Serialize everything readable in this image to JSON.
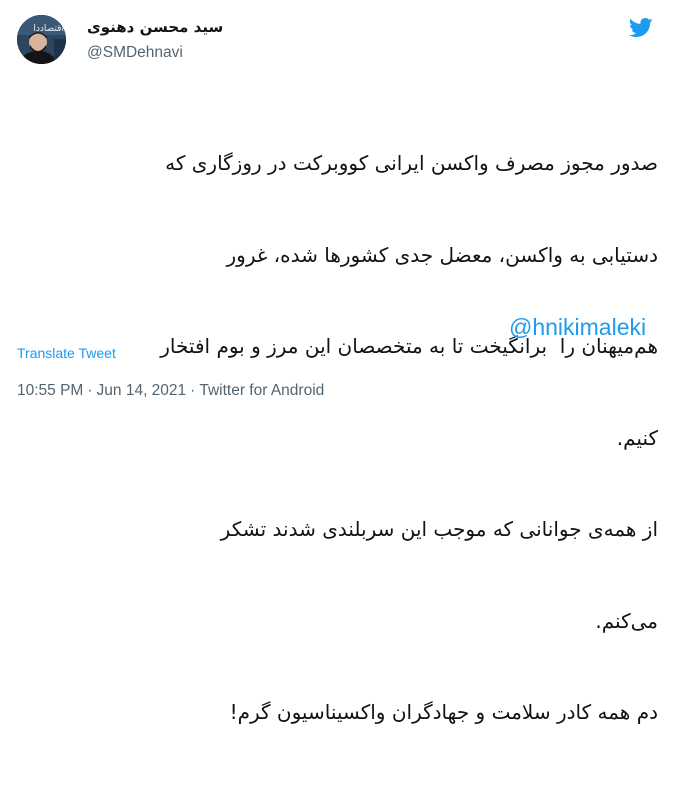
{
  "author": {
    "display_name": "سید محسن دهنوی",
    "handle": "@SMDehnavi",
    "avatar_text": "اقتصاددا"
  },
  "tweet": {
    "lines": [
      "صدور مجوز مصرف واکسن ایرانی کووبرکت در روزگاری که",
      "دستیابی به واکسن، معضل جدی کشورها شده، غرور",
      "هم‌میهنان را  برانگیخت تا به متخصصان این مرز و بوم افتخار",
      "کنیم.",
      "از همه‌ی جوانانی که موجب این سربلندی شدند تشکر",
      "می‌کنم.",
      "دم همه کادر سلامت و جهادگران واکسیناسیون گرم!"
    ],
    "mention": "@hnikimaleki"
  },
  "actions": {
    "translate_label": "Translate Tweet"
  },
  "meta": {
    "time": "10:55 PM",
    "separator": "·",
    "date": "Jun 14, 2021",
    "source": "Twitter for Android"
  },
  "icons": {
    "brand": "twitter-bird-icon"
  },
  "colors": {
    "accent": "#1d9bf0",
    "text": "#0f1419",
    "secondary": "#536471"
  }
}
